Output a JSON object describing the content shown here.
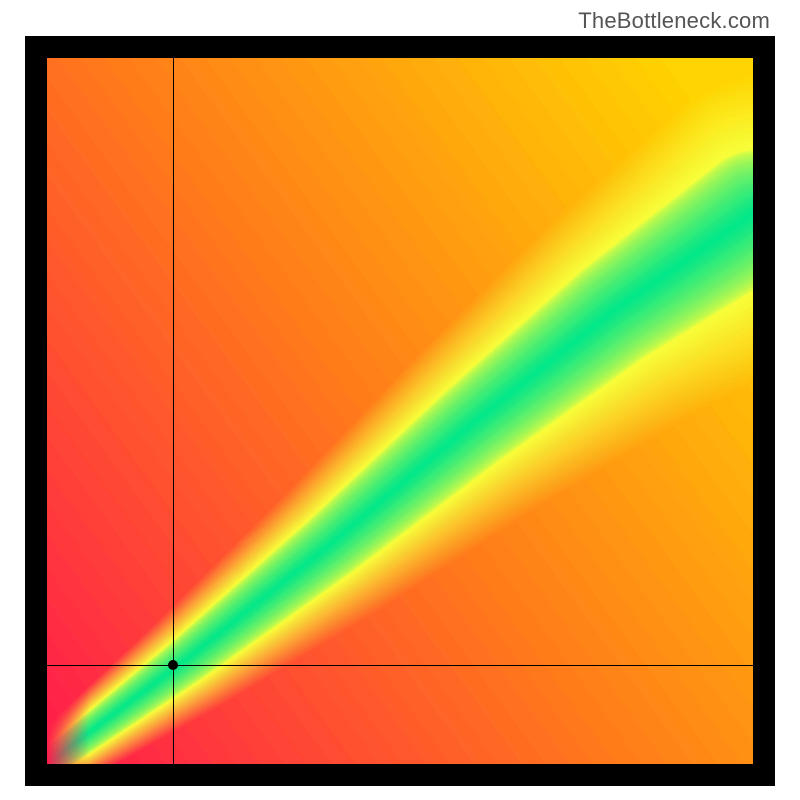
{
  "attribution": "TheBottleneck.com",
  "chart_data": {
    "type": "heatmap",
    "title": "",
    "xlabel": "",
    "ylabel": "",
    "xlim": [
      0,
      1
    ],
    "ylim": [
      0,
      1
    ],
    "crosshair": {
      "x": 0.178,
      "y": 0.14
    },
    "marker": {
      "x": 0.178,
      "y": 0.14
    },
    "ideal_curve": {
      "control_points_x": [
        0,
        0.2,
        0.4,
        0.6,
        0.8,
        1.0
      ],
      "control_points_y": [
        0,
        0.15,
        0.31,
        0.48,
        0.64,
        0.78
      ]
    },
    "band": {
      "half_width_near": 0.02,
      "half_width_far": 0.09
    },
    "colors": {
      "worst": "#ff1a4d",
      "bad": "#ff7a1a",
      "mid": "#ffd400",
      "near": "#f7ff3a",
      "best": "#00e68a"
    }
  }
}
